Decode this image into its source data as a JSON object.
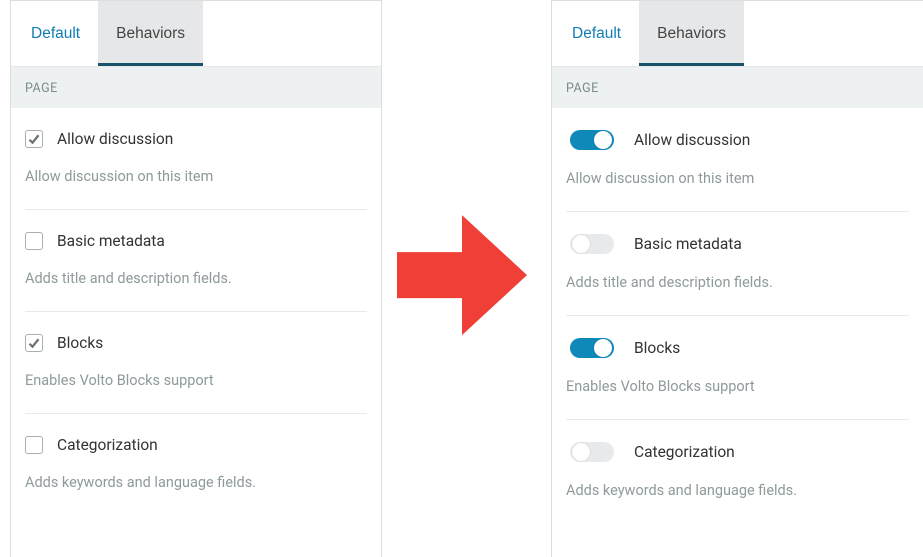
{
  "tabs": {
    "default": "Default",
    "behaviors": "Behaviors"
  },
  "section_label": "PAGE",
  "items": [
    {
      "label": "Allow discussion",
      "desc": "Allow discussion on this item",
      "checked": true
    },
    {
      "label": "Basic metadata",
      "desc": "Adds title and description fields.",
      "checked": false
    },
    {
      "label": "Blocks",
      "desc": "Enables Volto Blocks support",
      "checked": true
    },
    {
      "label": "Categorization",
      "desc": "Adds keywords and language fields.",
      "checked": false
    }
  ]
}
